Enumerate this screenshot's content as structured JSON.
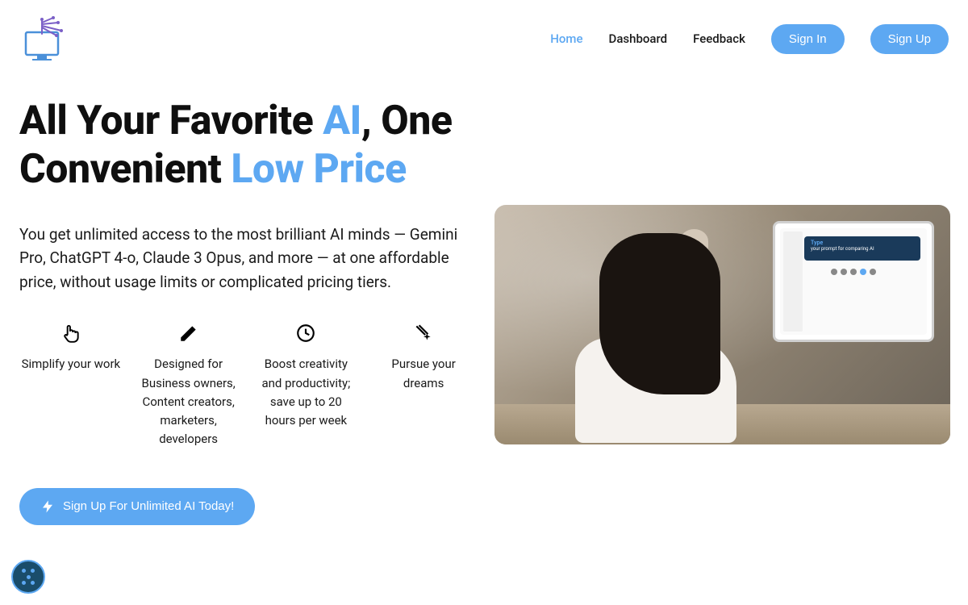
{
  "nav": {
    "home": "Home",
    "dashboard": "Dashboard",
    "feedback": "Feedback",
    "signin": "Sign In",
    "signup": "Sign Up"
  },
  "hero": {
    "headline_part1": "All Your Favorite ",
    "headline_accent1": "AI",
    "headline_part2": ", One Convenient ",
    "headline_accent2": "Low Price",
    "subtext": "You get unlimited access to the most brilliant AI minds — Gemini Pro, ChatGPT 4-o, Claude 3 Opus, and more — at one affordable price, without usage limits or complicated pricing tiers."
  },
  "features": [
    {
      "text": "Simplify your work"
    },
    {
      "text": "Designed for Business owners, Content creators, marketers, developers"
    },
    {
      "text": "Boost creativity and productivity; save up to 20 hours per week"
    },
    {
      "text": "Pursue your dreams"
    }
  ],
  "cta": {
    "label": "Sign Up For Unlimited AI Today!"
  },
  "monitor": {
    "text1": "Type",
    "text2": "your prompt for comparing AI"
  }
}
